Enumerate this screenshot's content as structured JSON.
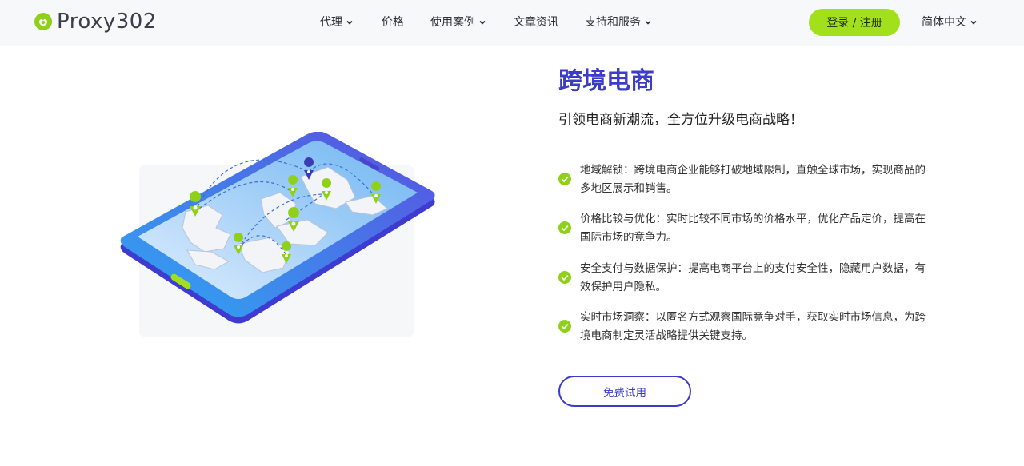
{
  "header": {
    "logo_text": "Proxy302",
    "nav": [
      {
        "label": "代理",
        "has_dropdown": true
      },
      {
        "label": "价格",
        "has_dropdown": false
      },
      {
        "label": "使用案例",
        "has_dropdown": true
      },
      {
        "label": "文章资讯",
        "has_dropdown": false
      },
      {
        "label": "支持和服务",
        "has_dropdown": true
      }
    ],
    "login_label": "登录 / 注册",
    "language_label": "简体中文"
  },
  "main": {
    "title": "跨境电商",
    "subtitle": "引领电商新潮流，全方位升级电商战略！",
    "features": [
      {
        "text": "地域解锁：跨境电商企业能够打破地域限制，直触全球市场，实现商品的多地区展示和销售。"
      },
      {
        "text": "价格比较与优化：实时比较不同市场的价格水平，优化产品定价，提高在国际市场的竞争力。"
      },
      {
        "text": "安全支付与数据保护：提高电商平台上的支付安全性，隐藏用户数据，有效保护用户隐私。"
      },
      {
        "text": "实时市场洞察：以匿名方式观察国际竞争对手，获取实时市场信息，为跨境电商制定灵活战略提供关键支持。"
      }
    ],
    "trial_label": "免费试用"
  },
  "colors": {
    "accent_green": "#a3e01c",
    "brand_blue": "#3c3cc6",
    "check_green": "#8fd11a"
  },
  "icons": {
    "logo": "proxy302-logo-icon",
    "chevron": "chevron-down-icon",
    "check": "check-circle-icon",
    "illustration": "phone-world-map-illustration"
  }
}
